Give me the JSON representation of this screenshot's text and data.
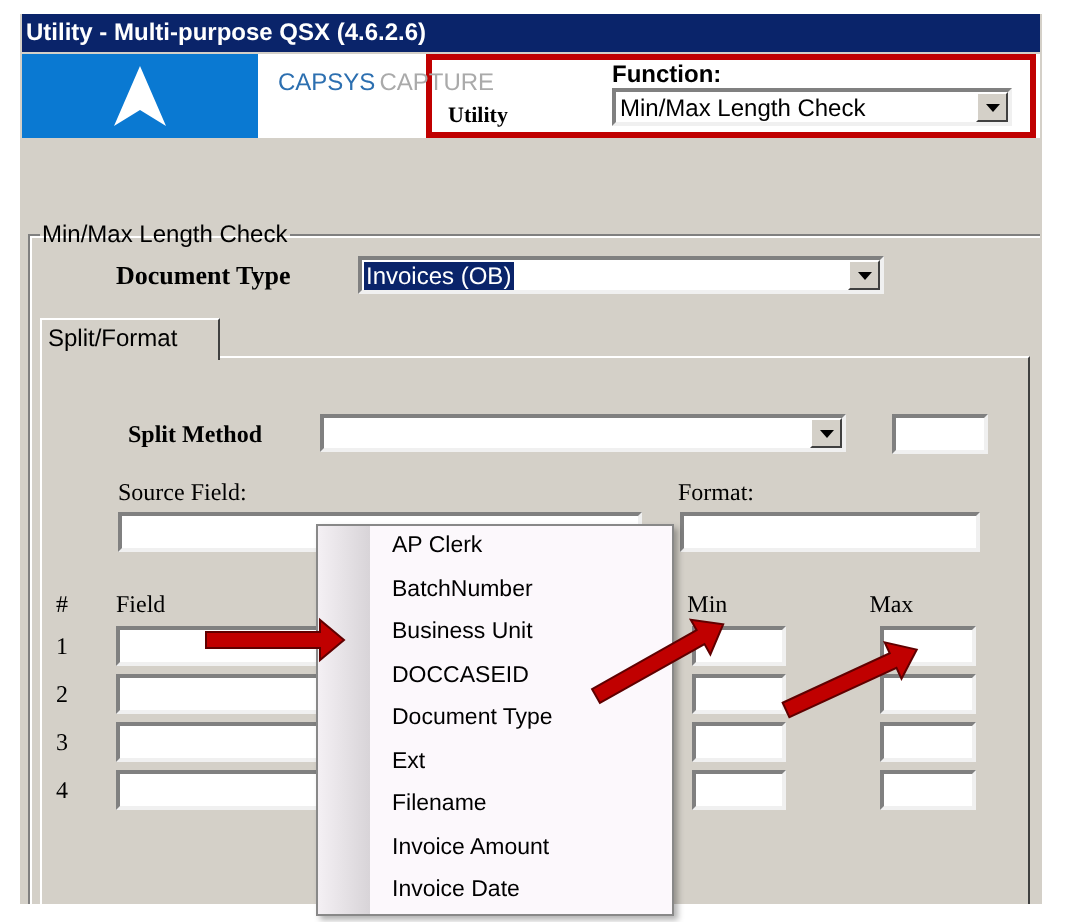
{
  "window": {
    "title": "Utility - Multi-purpose QSX (4.6.2.6)"
  },
  "header": {
    "brand_left": "CAPSYS",
    "brand_right": "CAPTURE",
    "utility_label": "Utility",
    "function_label": "Function:",
    "function_value": "Min/Max Length Check"
  },
  "group": {
    "title": "Min/Max Length Check",
    "document_type_label": "Document Type",
    "document_type_value": "Invoices (OB)"
  },
  "tabs": [
    {
      "label": "Split/Format",
      "selected": true
    }
  ],
  "split_method_label": "Split Method",
  "source_field_label": "Source Field:",
  "format_label": "Format:",
  "grid": {
    "columns": [
      "#",
      "Field",
      "Min",
      "Max"
    ],
    "rows": [
      "1",
      "2",
      "3",
      "4"
    ]
  },
  "context_menu": {
    "items": [
      "AP Clerk",
      "BatchNumber",
      "Business Unit",
      "DOCCASEID",
      "Document Type",
      "Ext",
      "Filename",
      "Invoice Amount",
      "Invoice Date"
    ]
  }
}
